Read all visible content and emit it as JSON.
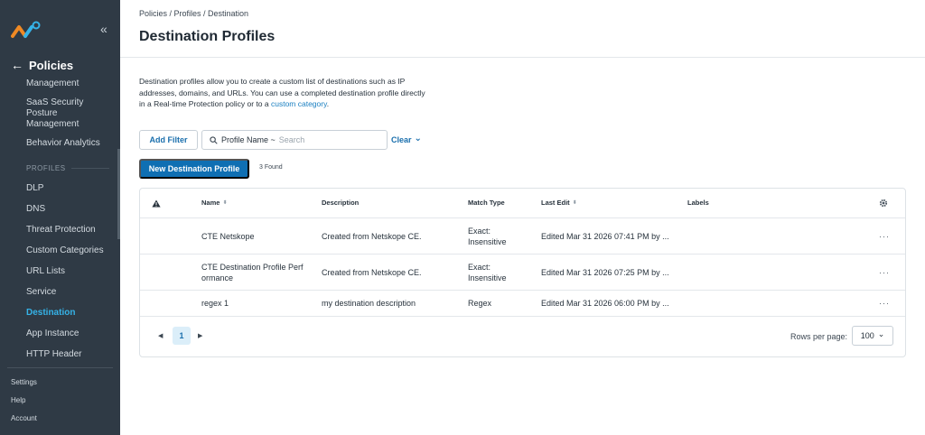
{
  "sidebar": {
    "back_arrow": "←",
    "title": "Policies",
    "collapse_glyph": "«",
    "items": [
      {
        "label": "Management"
      },
      {
        "label": "SaaS Security Posture Management"
      },
      {
        "label": "Behavior Analytics"
      },
      {
        "label": "DLP"
      },
      {
        "label": "DNS"
      },
      {
        "label": "Threat Protection"
      },
      {
        "label": "Custom Categories"
      },
      {
        "label": "URL Lists"
      },
      {
        "label": "Service"
      },
      {
        "label": "Destination"
      },
      {
        "label": "App Instance"
      },
      {
        "label": "HTTP Header"
      }
    ],
    "section_profiles": "PROFILES",
    "bottom": {
      "settings": "Settings",
      "help": "Help",
      "account": "Account"
    },
    "logo_colors": {
      "orange": "#f08a24",
      "blue": "#35b3e8"
    }
  },
  "breadcrumb": "Policies / Profiles / Destination",
  "page_title": "Destination Profiles",
  "description": {
    "line1": "Destination profiles allow you to create a custom list of destinations such as IP",
    "line2": "addresses, domains, and URLs. You can use a completed destination profile directly",
    "line3": "in a Real-time Protection policy or to a ",
    "link": "custom category",
    "end": "."
  },
  "filters": {
    "add_filter": "Add Filter",
    "field": "Profile Name ~",
    "placeholder": "Search",
    "clear": "Clear",
    "clear_chevron": "⌄"
  },
  "actions": {
    "new_profile": "New Destination Profile",
    "found": "3 Found"
  },
  "table": {
    "columns": {
      "name": "Name",
      "description": "Description",
      "match_type": "Match Type",
      "last_edit": "Last Edit",
      "labels": "Labels"
    },
    "sort_glyph": "⬍",
    "sort_desc_glyph": "⬍",
    "more_glyph": "···",
    "rows": [
      {
        "name_1": "CTE Netskope",
        "name_2": "",
        "description": "Created from Netskope CE.",
        "match_1": "Exact:",
        "match_2": "Insensitive",
        "last_edit": "Edited Mar 31 2026 07:41 PM by ..."
      },
      {
        "name_1": "CTE Destination Profile Perf",
        "name_2": "ormance",
        "description": "Created from Netskope CE.",
        "match_1": "Exact:",
        "match_2": "Insensitive",
        "last_edit": "Edited Mar 31 2026 07:25 PM by ..."
      },
      {
        "name_1": "regex 1",
        "name_2": "",
        "description": "my destination description",
        "match_1": "Regex",
        "match_2": "",
        "last_edit": "Edited Mar 31 2026 06:00 PM by ..."
      }
    ]
  },
  "pagination": {
    "prev": "◀",
    "page": "1",
    "next": "▶",
    "rows_per_page_label": "Rows per page:",
    "rows_per_page_value": "100",
    "chevron": "⌄"
  },
  "colors": {
    "accent": "#0f6fb3",
    "sidebar_bg": "#2f3a45",
    "active_nav": "#35b3e8"
  }
}
